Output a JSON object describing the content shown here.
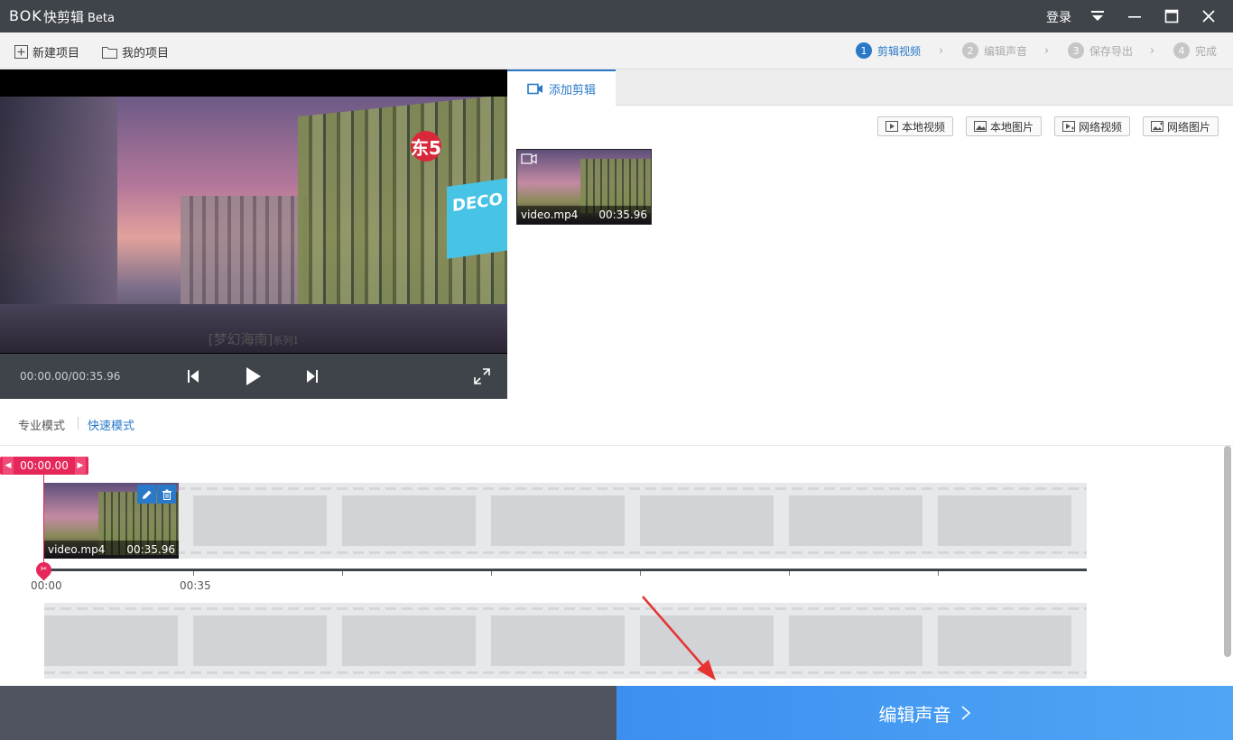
{
  "app": {
    "logo": "BOK",
    "title": "快剪辑",
    "beta": "Beta",
    "login": "登录"
  },
  "toolbar": {
    "new_project": "新建项目",
    "my_projects": "我的项目"
  },
  "steps": [
    {
      "num": "1",
      "label": "剪辑视频",
      "active": true
    },
    {
      "num": "2",
      "label": "编辑声音",
      "active": false
    },
    {
      "num": "3",
      "label": "保存导出",
      "active": false
    },
    {
      "num": "4",
      "label": "完成",
      "active": false
    }
  ],
  "preview": {
    "caption_main": "[梦幻海南]",
    "caption_sub": "系列1",
    "time": "00:00.00/00:35.96",
    "sign_text": "DECO",
    "badge_text": "东5"
  },
  "library": {
    "tab": "添加剪辑",
    "sources": [
      "本地视频",
      "本地图片",
      "网络视频",
      "网络图片"
    ],
    "clip": {
      "name": "video.mp4",
      "duration": "00:35.96"
    }
  },
  "modes": {
    "pro": "专业模式",
    "quick": "快速模式"
  },
  "timeline": {
    "playhead_time": "00:00.00",
    "clip": {
      "name": "video.mp4",
      "duration": "00:35.96"
    },
    "ticks": [
      "00:00",
      "00:35"
    ]
  },
  "next_button": "编辑声音",
  "colors": {
    "accent": "#2a79c9",
    "playhead": "#e5275a",
    "titlebar": "#3f434a",
    "next": "#3c8ff0"
  }
}
